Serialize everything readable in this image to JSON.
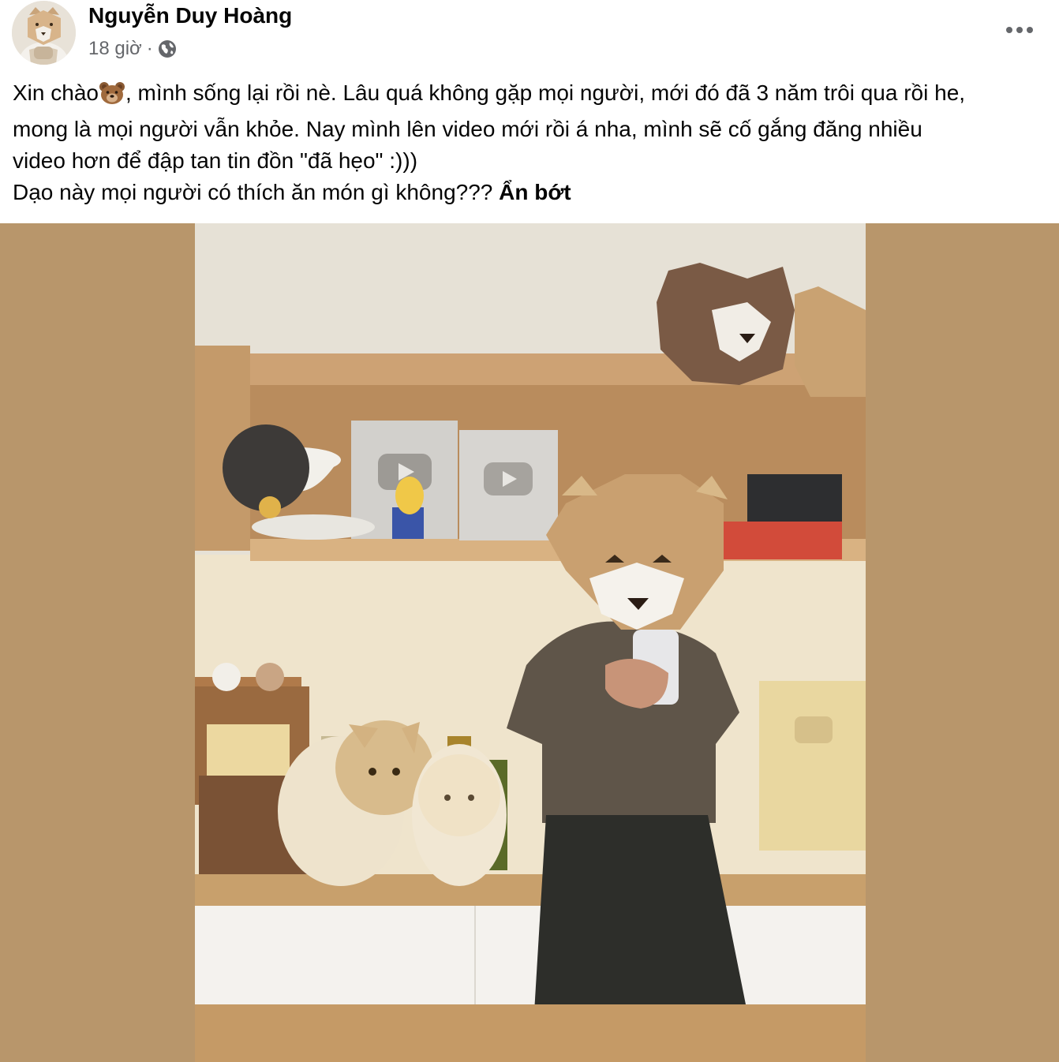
{
  "post": {
    "author": "Nguyễn Duy Hoàng",
    "time": "18 giờ",
    "separator": "·",
    "audience_icon": "globe-icon",
    "more_icon": "more-options-icon",
    "text_part1": "Xin chào",
    "text_part2": ", mình sống lại rồi nè. Lâu quá không gặp mọi người, mới đó đã 3 năm trôi qua rồi he,",
    "text_line2": "mong là mọi người vẫn khỏe. Nay mình lên video mới rồi á nha, mình sẽ cố gắng đăng nhiều",
    "text_line3": "video hơn để đập tan tin đồn \"đã hẹo\" :)))",
    "text_line4": "Dạo này mọi người có thích ăn món gì không???",
    "see_less": "Ẩn bớt",
    "emoji": "bear-face-emoji"
  },
  "media": {
    "background_color": "#b8966b",
    "scene": "kitchen-photo"
  }
}
